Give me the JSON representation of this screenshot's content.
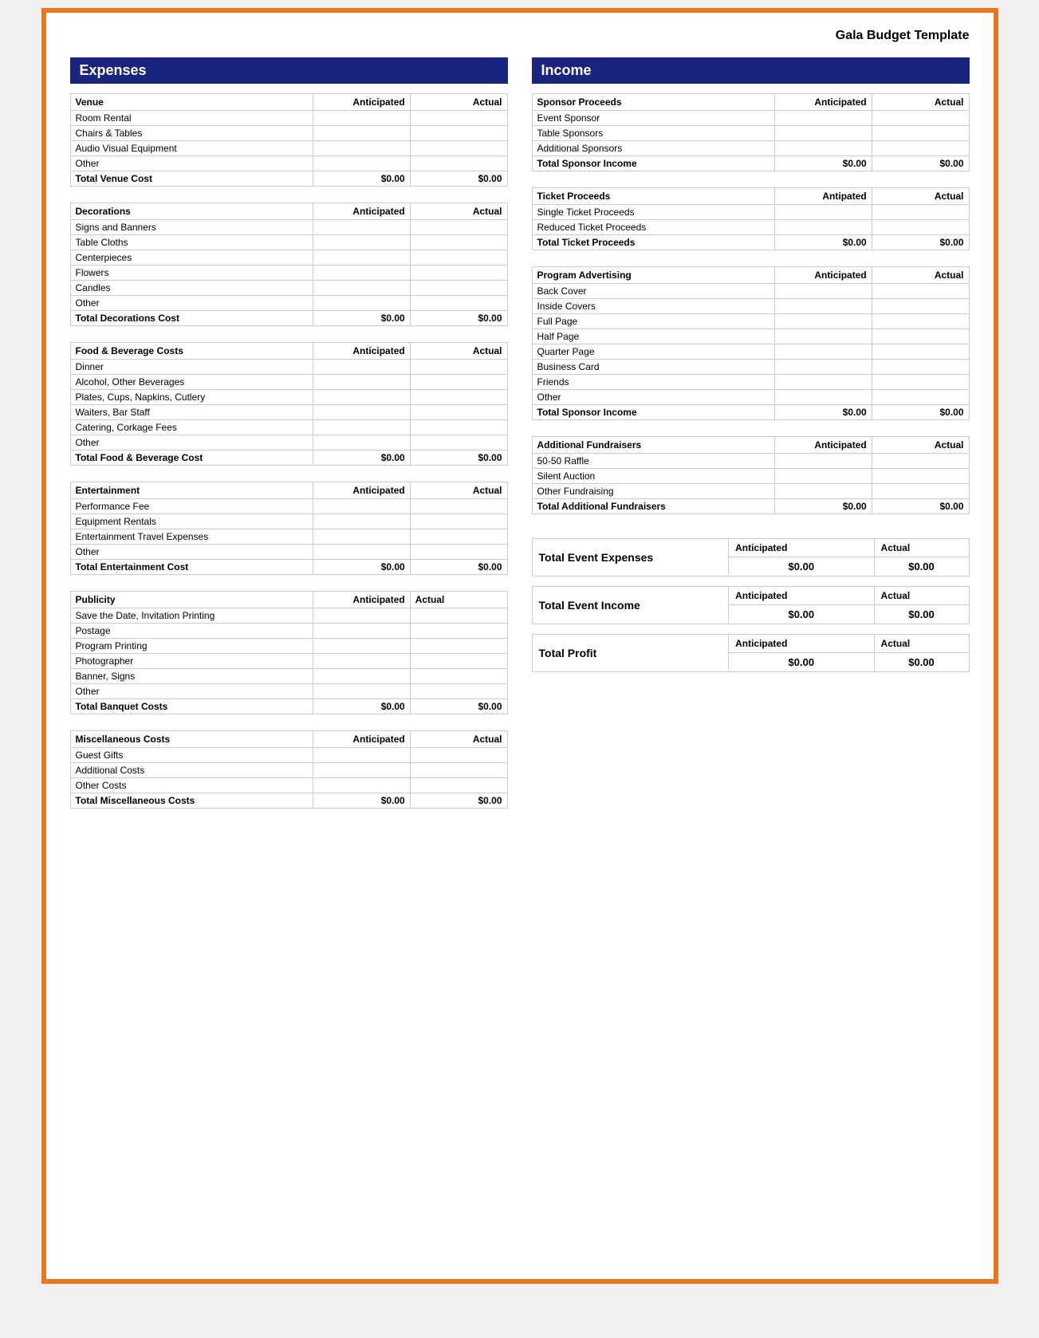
{
  "page": {
    "title": "Gala Budget Template",
    "border_color": "#e87722"
  },
  "sections": {
    "expenses_header": "Expenses",
    "income_header": "Income"
  },
  "expenses": {
    "venue": {
      "header": "Venue",
      "col_anticipated": "Anticipated",
      "col_actual": "Actual",
      "rows": [
        "Room Rental",
        "Chairs & Tables",
        "Audio Visual Equipment",
        "Other"
      ],
      "total_label": "Total Venue Cost",
      "total_anticipated": "$0.00",
      "total_actual": "$0.00"
    },
    "decorations": {
      "header": "Decorations",
      "col_anticipated": "Anticipated",
      "col_actual": "Actual",
      "rows": [
        "Signs and Banners",
        "Table Cloths",
        "Centerpieces",
        "Flowers",
        "Candles",
        "Other"
      ],
      "total_label": "Total Decorations Cost",
      "total_anticipated": "$0.00",
      "total_actual": "$0.00"
    },
    "food_beverage": {
      "header": "Food & Beverage Costs",
      "col_anticipated": "Anticipated",
      "col_actual": "Actual",
      "rows": [
        "Dinner",
        "Alcohol, Other Beverages",
        "Plates, Cups, Napkins, Cutlery",
        "Waiters, Bar Staff",
        "Catering, Corkage Fees",
        "Other"
      ],
      "total_label": "Total Food & Beverage Cost",
      "total_anticipated": "$0.00",
      "total_actual": "$0.00"
    },
    "entertainment": {
      "header": "Entertainment",
      "col_anticipated": "Anticipated",
      "col_actual": "Actual",
      "rows": [
        "Performance Fee",
        "Equipment Rentals",
        "Entertainment Travel Expenses",
        "Other"
      ],
      "total_label": "Total Entertainment Cost",
      "total_anticipated": "$0.00",
      "total_actual": "$0.00"
    },
    "publicity": {
      "header": "Publicity",
      "col_anticipated": "Anticipated",
      "col_actual": "Actual",
      "rows": [
        "Save the Date, Invitation Printing",
        "Postage",
        "Program Printing",
        "Photographer",
        "Banner, Signs",
        "Other"
      ],
      "total_label": "Total Banquet Costs",
      "total_anticipated": "$0.00",
      "total_actual": "$0.00"
    },
    "miscellaneous": {
      "header": "Miscellaneous Costs",
      "col_anticipated": "Anticipated",
      "col_actual": "Actual",
      "rows": [
        "Guest Gifts",
        "Additional Costs",
        "Other Costs"
      ],
      "total_label": "Total Miscellaneous Costs",
      "total_anticipated": "$0.00",
      "total_actual": "$0.00"
    }
  },
  "income": {
    "sponsor": {
      "header": "Sponsor Proceeds",
      "col_anticipated": "Anticipated",
      "col_actual": "Actual",
      "rows": [
        "Event Sponsor",
        "Table Sponsors",
        "Additional Sponsors"
      ],
      "total_label": "Total Sponsor Income",
      "total_anticipated": "$0.00",
      "total_actual": "$0.00"
    },
    "ticket": {
      "header": "Ticket Proceeds",
      "col_anticipated": "Antipated",
      "col_actual": "Actual",
      "rows": [
        "Single Ticket Proceeds",
        "Reduced Ticket Proceeds"
      ],
      "total_label": "Total Ticket Proceeds",
      "total_anticipated": "$0.00",
      "total_actual": "$0.00"
    },
    "program_advertising": {
      "header": "Program Advertising",
      "col_anticipated": "Anticipated",
      "col_actual": "Actual",
      "rows": [
        "Back Cover",
        "Inside Covers",
        "Full Page",
        "Half Page",
        "Quarter Page",
        "Business Card",
        "Friends",
        "Other"
      ],
      "total_label": "Total Sponsor Income",
      "total_anticipated": "$0.00",
      "total_actual": "$0.00"
    },
    "additional_fundraisers": {
      "header": "Additional Fundraisers",
      "col_anticipated": "Anticipated",
      "col_actual": "Actual",
      "rows": [
        "50-50 Raffle",
        "Silent Auction",
        "Other Fundraising"
      ],
      "total_label": "Total Additional Fundraisers",
      "total_anticipated": "$0.00",
      "total_actual": "$0.00"
    }
  },
  "summary": {
    "total_expenses": {
      "label": "Total Event Expenses",
      "col_anticipated": "Anticipated",
      "col_actual": "Actual",
      "val_anticipated": "$0.00",
      "val_actual": "$0.00"
    },
    "total_income": {
      "label": "Total Event Income",
      "col_anticipated": "Anticipated",
      "col_actual": "Actual",
      "val_anticipated": "$0.00",
      "val_actual": "$0.00"
    },
    "total_profit": {
      "label": "Total Profit",
      "col_anticipated": "Anticipated",
      "col_actual": "Actual",
      "val_anticipated": "$0.00",
      "val_actual": "$0.00"
    }
  }
}
